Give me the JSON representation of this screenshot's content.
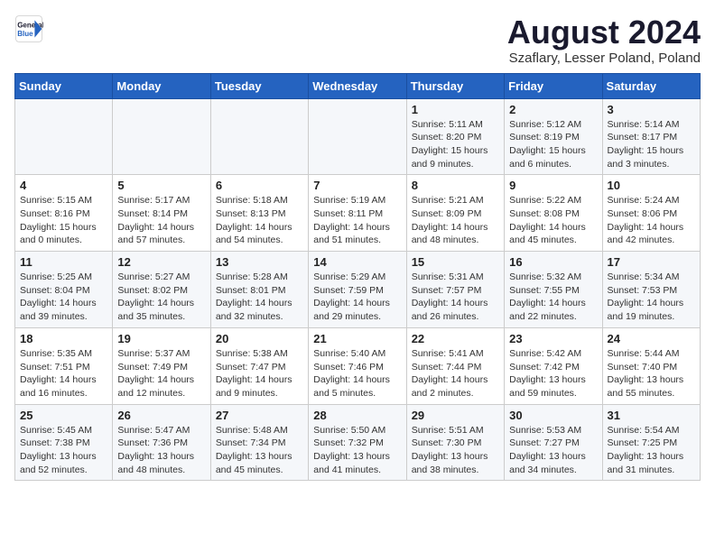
{
  "header": {
    "logo_line1": "General",
    "logo_line2": "Blue",
    "month": "August 2024",
    "location": "Szaflary, Lesser Poland, Poland"
  },
  "weekdays": [
    "Sunday",
    "Monday",
    "Tuesday",
    "Wednesday",
    "Thursday",
    "Friday",
    "Saturday"
  ],
  "weeks": [
    [
      {
        "day": "",
        "detail": ""
      },
      {
        "day": "",
        "detail": ""
      },
      {
        "day": "",
        "detail": ""
      },
      {
        "day": "",
        "detail": ""
      },
      {
        "day": "1",
        "detail": "Sunrise: 5:11 AM\nSunset: 8:20 PM\nDaylight: 15 hours\nand 9 minutes."
      },
      {
        "day": "2",
        "detail": "Sunrise: 5:12 AM\nSunset: 8:19 PM\nDaylight: 15 hours\nand 6 minutes."
      },
      {
        "day": "3",
        "detail": "Sunrise: 5:14 AM\nSunset: 8:17 PM\nDaylight: 15 hours\nand 3 minutes."
      }
    ],
    [
      {
        "day": "4",
        "detail": "Sunrise: 5:15 AM\nSunset: 8:16 PM\nDaylight: 15 hours\nand 0 minutes."
      },
      {
        "day": "5",
        "detail": "Sunrise: 5:17 AM\nSunset: 8:14 PM\nDaylight: 14 hours\nand 57 minutes."
      },
      {
        "day": "6",
        "detail": "Sunrise: 5:18 AM\nSunset: 8:13 PM\nDaylight: 14 hours\nand 54 minutes."
      },
      {
        "day": "7",
        "detail": "Sunrise: 5:19 AM\nSunset: 8:11 PM\nDaylight: 14 hours\nand 51 minutes."
      },
      {
        "day": "8",
        "detail": "Sunrise: 5:21 AM\nSunset: 8:09 PM\nDaylight: 14 hours\nand 48 minutes."
      },
      {
        "day": "9",
        "detail": "Sunrise: 5:22 AM\nSunset: 8:08 PM\nDaylight: 14 hours\nand 45 minutes."
      },
      {
        "day": "10",
        "detail": "Sunrise: 5:24 AM\nSunset: 8:06 PM\nDaylight: 14 hours\nand 42 minutes."
      }
    ],
    [
      {
        "day": "11",
        "detail": "Sunrise: 5:25 AM\nSunset: 8:04 PM\nDaylight: 14 hours\nand 39 minutes."
      },
      {
        "day": "12",
        "detail": "Sunrise: 5:27 AM\nSunset: 8:02 PM\nDaylight: 14 hours\nand 35 minutes."
      },
      {
        "day": "13",
        "detail": "Sunrise: 5:28 AM\nSunset: 8:01 PM\nDaylight: 14 hours\nand 32 minutes."
      },
      {
        "day": "14",
        "detail": "Sunrise: 5:29 AM\nSunset: 7:59 PM\nDaylight: 14 hours\nand 29 minutes."
      },
      {
        "day": "15",
        "detail": "Sunrise: 5:31 AM\nSunset: 7:57 PM\nDaylight: 14 hours\nand 26 minutes."
      },
      {
        "day": "16",
        "detail": "Sunrise: 5:32 AM\nSunset: 7:55 PM\nDaylight: 14 hours\nand 22 minutes."
      },
      {
        "day": "17",
        "detail": "Sunrise: 5:34 AM\nSunset: 7:53 PM\nDaylight: 14 hours\nand 19 minutes."
      }
    ],
    [
      {
        "day": "18",
        "detail": "Sunrise: 5:35 AM\nSunset: 7:51 PM\nDaylight: 14 hours\nand 16 minutes."
      },
      {
        "day": "19",
        "detail": "Sunrise: 5:37 AM\nSunset: 7:49 PM\nDaylight: 14 hours\nand 12 minutes."
      },
      {
        "day": "20",
        "detail": "Sunrise: 5:38 AM\nSunset: 7:47 PM\nDaylight: 14 hours\nand 9 minutes."
      },
      {
        "day": "21",
        "detail": "Sunrise: 5:40 AM\nSunset: 7:46 PM\nDaylight: 14 hours\nand 5 minutes."
      },
      {
        "day": "22",
        "detail": "Sunrise: 5:41 AM\nSunset: 7:44 PM\nDaylight: 14 hours\nand 2 minutes."
      },
      {
        "day": "23",
        "detail": "Sunrise: 5:42 AM\nSunset: 7:42 PM\nDaylight: 13 hours\nand 59 minutes."
      },
      {
        "day": "24",
        "detail": "Sunrise: 5:44 AM\nSunset: 7:40 PM\nDaylight: 13 hours\nand 55 minutes."
      }
    ],
    [
      {
        "day": "25",
        "detail": "Sunrise: 5:45 AM\nSunset: 7:38 PM\nDaylight: 13 hours\nand 52 minutes."
      },
      {
        "day": "26",
        "detail": "Sunrise: 5:47 AM\nSunset: 7:36 PM\nDaylight: 13 hours\nand 48 minutes."
      },
      {
        "day": "27",
        "detail": "Sunrise: 5:48 AM\nSunset: 7:34 PM\nDaylight: 13 hours\nand 45 minutes."
      },
      {
        "day": "28",
        "detail": "Sunrise: 5:50 AM\nSunset: 7:32 PM\nDaylight: 13 hours\nand 41 minutes."
      },
      {
        "day": "29",
        "detail": "Sunrise: 5:51 AM\nSunset: 7:30 PM\nDaylight: 13 hours\nand 38 minutes."
      },
      {
        "day": "30",
        "detail": "Sunrise: 5:53 AM\nSunset: 7:27 PM\nDaylight: 13 hours\nand 34 minutes."
      },
      {
        "day": "31",
        "detail": "Sunrise: 5:54 AM\nSunset: 7:25 PM\nDaylight: 13 hours\nand 31 minutes."
      }
    ]
  ]
}
